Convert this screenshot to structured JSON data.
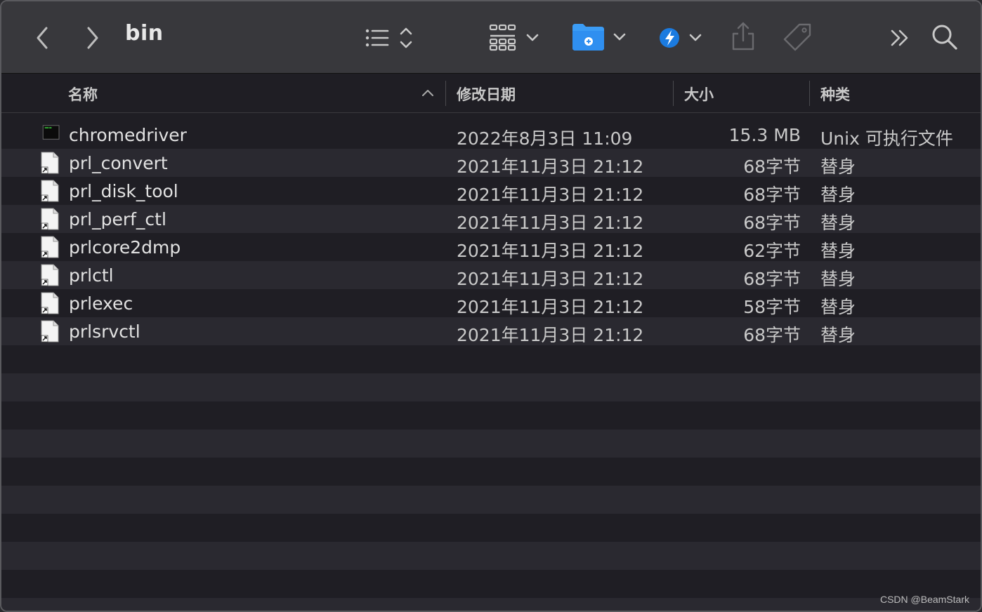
{
  "window": {
    "title": "bin"
  },
  "toolbar": {
    "icons": [
      "back-icon",
      "forward-icon",
      "list-view-icon",
      "sort-icon",
      "group-icon",
      "folder-icon",
      "lightning-icon",
      "share-icon",
      "tag-icon",
      "more-icon",
      "search-icon"
    ]
  },
  "columns": {
    "name": "名称",
    "date": "修改日期",
    "size": "大小",
    "kind": "种类"
  },
  "files": [
    {
      "name": "chromedriver",
      "date": "2022年8月3日 11:09",
      "size": "15.3 MB",
      "kind": "Unix 可执行文件",
      "icon": "terminal-exec-icon"
    },
    {
      "name": "prl_convert",
      "date": "2021年11月3日 21:12",
      "size": "68字节",
      "kind": "替身",
      "icon": "alias-file-icon"
    },
    {
      "name": "prl_disk_tool",
      "date": "2021年11月3日 21:12",
      "size": "68字节",
      "kind": "替身",
      "icon": "alias-file-icon"
    },
    {
      "name": "prl_perf_ctl",
      "date": "2021年11月3日 21:12",
      "size": "68字节",
      "kind": "替身",
      "icon": "alias-file-icon"
    },
    {
      "name": "prlcore2dmp",
      "date": "2021年11月3日 21:12",
      "size": "62字节",
      "kind": "替身",
      "icon": "alias-file-icon"
    },
    {
      "name": "prlctl",
      "date": "2021年11月3日 21:12",
      "size": "68字节",
      "kind": "替身",
      "icon": "alias-file-icon"
    },
    {
      "name": "prlexec",
      "date": "2021年11月3日 21:12",
      "size": "58字节",
      "kind": "替身",
      "icon": "alias-file-icon"
    },
    {
      "name": "prlsrvctl",
      "date": "2021年11月3日 21:12",
      "size": "68字节",
      "kind": "替身",
      "icon": "alias-file-icon"
    }
  ],
  "watermark": "CSDN @BeamStark",
  "colors": {
    "toolbar_bg": "#38383c",
    "list_bg": "#1f1e24",
    "alt_row_bg": "#2a2930",
    "accent_blue": "#2f8ff0"
  }
}
